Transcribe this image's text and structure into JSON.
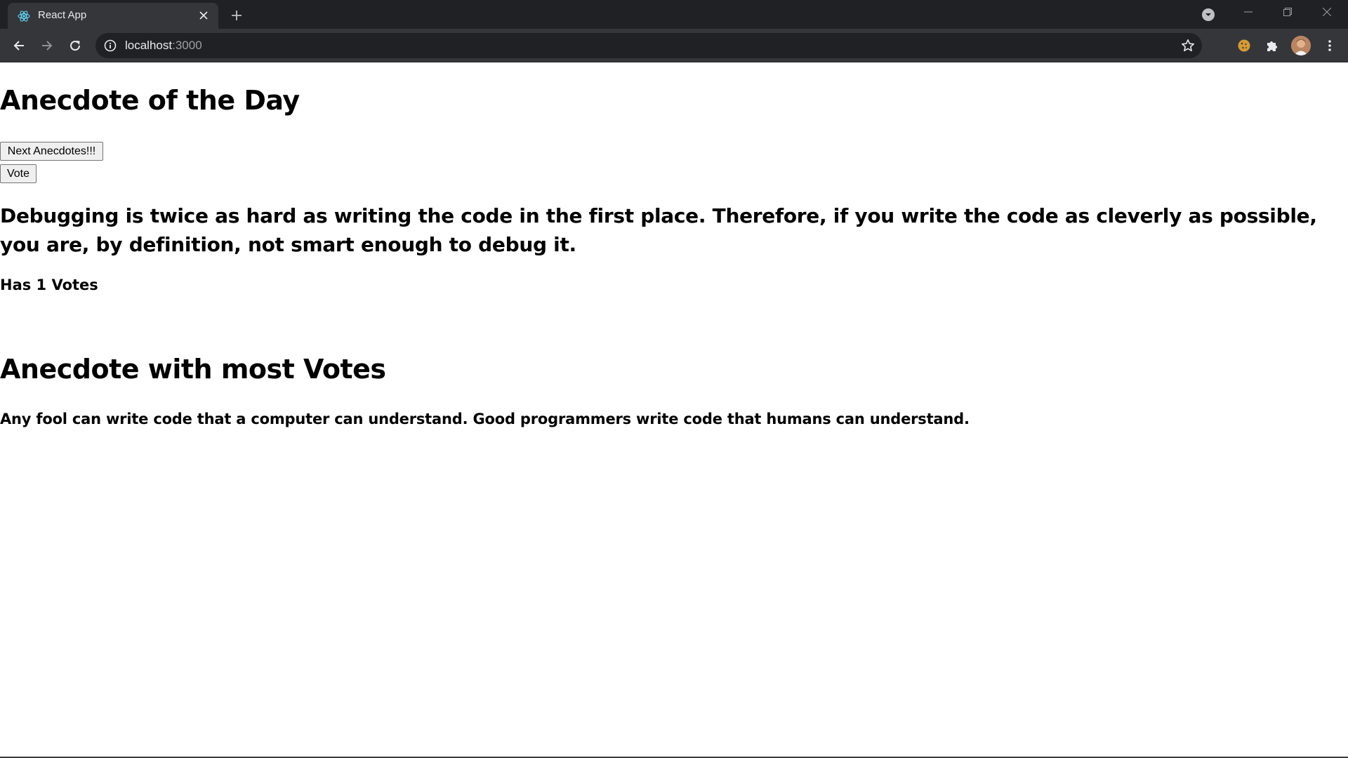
{
  "browser": {
    "tab": {
      "title": "React App"
    },
    "url": {
      "host": "localhost",
      "port": ":3000"
    },
    "icons": {
      "favicon": "react-logo-icon",
      "tab_close": "close-icon",
      "new_tab": "plus-icon",
      "tab_search": "chevron-down-circle-icon",
      "back": "arrow-left-icon",
      "forward": "arrow-right-icon",
      "reload": "reload-icon",
      "site_info": "info-icon",
      "bookmark": "star-icon",
      "cookie_ext": "cookie-icon",
      "extensions": "puzzle-icon",
      "menu": "kebab-menu-icon"
    },
    "colors": {
      "tabstrip": "#202124",
      "toolbar": "#35363a",
      "omnibox": "#202124"
    }
  },
  "app": {
    "heading": "Anecdote of the Day",
    "next_button": "Next Anecdotes!!!",
    "vote_button": "Vote",
    "anecdote": "Debugging is twice as hard as writing the code in the first place. Therefore, if you write the code as cleverly as possible, you are, by definition, not smart enough to debug it.",
    "votes_text": "Has 1 Votes",
    "most_votes_heading": "Anecdote with most Votes",
    "most_votes_anecdote": "Any fool can write code that a computer can understand. Good programmers write code that humans can understand."
  }
}
